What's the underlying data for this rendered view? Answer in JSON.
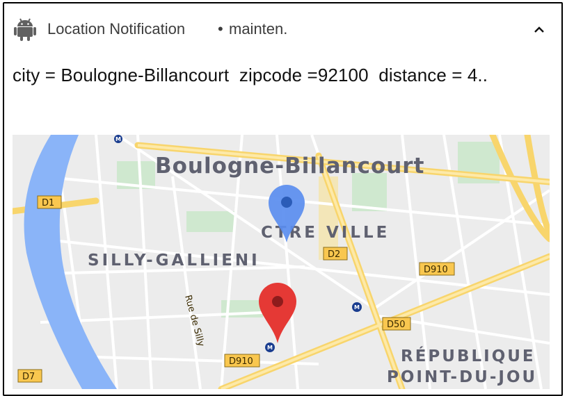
{
  "notification": {
    "app_name": "Location Notification",
    "separator": "•",
    "channel": "mainten.",
    "icons": {
      "app": "android-icon",
      "expand": "chevron-up-icon"
    },
    "content": "city = Boulogne-Billancourt  zipcode =92100  distance = 4.."
  },
  "map": {
    "labels": {
      "city": "Boulogne-Billancourt",
      "district1": "CTRE VILLE",
      "district2": "SILLY-GALLIENI",
      "district3a": "RÉPUBLIQUE",
      "district3b": "POINT-DU-JOU",
      "street": "Rue de Silly"
    },
    "road_shields": {
      "d1": "D1",
      "d2": "D2",
      "d910a": "D910",
      "d910b": "D910",
      "d50": "D50",
      "d7": "D7"
    },
    "markers": {
      "blue": "blue-location-pin",
      "red": "red-location-pin"
    },
    "colors": {
      "water": "#8ab4f8",
      "park": "#c8e6c9",
      "major_road": "#fde293",
      "blue_pin": "#4285f4",
      "red_pin": "#ea4335"
    }
  }
}
